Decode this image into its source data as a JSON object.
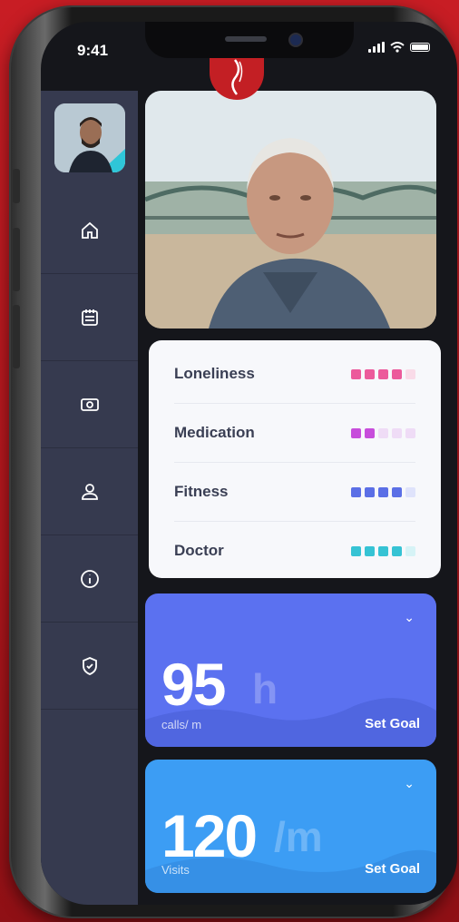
{
  "status_bar": {
    "time": "9:41"
  },
  "sidebar": {
    "items": [
      {
        "icon": "home-icon"
      },
      {
        "icon": "calendar-icon"
      },
      {
        "icon": "money-icon"
      },
      {
        "icon": "user-icon"
      },
      {
        "icon": "info-icon"
      },
      {
        "icon": "shield-icon"
      }
    ]
  },
  "metrics": [
    {
      "label": "Loneliness",
      "level": 4,
      "max": 5,
      "color": "#ec5a9b",
      "light": "#f9dbe8"
    },
    {
      "label": "Medication",
      "level": 2,
      "max": 5,
      "color": "#c74ddb",
      "light": "#efdcf6"
    },
    {
      "label": "Fitness",
      "level": 4,
      "max": 5,
      "color": "#5b6fe6",
      "light": "#dfe3fb"
    },
    {
      "label": "Doctor",
      "level": 4,
      "max": 5,
      "color": "#36c3d4",
      "light": "#d6f3f6"
    }
  ],
  "cards": {
    "calls": {
      "value": "95",
      "unit": "h",
      "caption": "calls/ m",
      "goal": "Set Goal",
      "color": "#5b71f0"
    },
    "visits": {
      "value": "120",
      "unit": "/m",
      "caption": "Visits",
      "goal": "Set Goal",
      "color": "#3c9df4"
    }
  }
}
